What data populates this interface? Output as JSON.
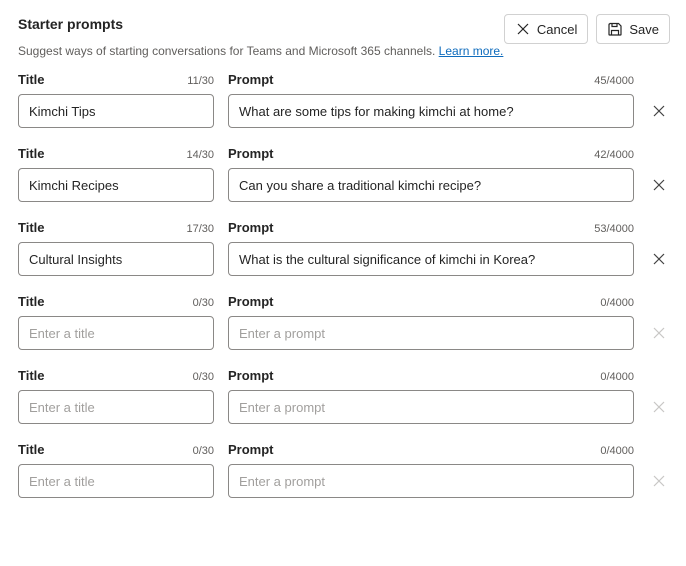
{
  "header": {
    "title": "Starter prompts",
    "subtitle_prefix": "Suggest ways of starting conversations for Teams and Microsoft 365 channels. ",
    "learn_more": "Learn more.",
    "cancel": "Cancel",
    "save": "Save"
  },
  "labels": {
    "title": "Title",
    "prompt": "Prompt",
    "title_max": 30,
    "prompt_max": 4000,
    "title_placeholder": "Enter a title",
    "prompt_placeholder": "Enter a prompt"
  },
  "rows": [
    {
      "title": "Kimchi Tips",
      "prompt": "What are some tips for making kimchi at home?",
      "title_count": "11/30",
      "prompt_count": "45/4000",
      "deletable": true
    },
    {
      "title": "Kimchi Recipes",
      "prompt": "Can you share a traditional kimchi recipe?",
      "title_count": "14/30",
      "prompt_count": "42/4000",
      "deletable": true
    },
    {
      "title": "Cultural Insights",
      "prompt": "What is the cultural significance of kimchi in Korea?",
      "title_count": "17/30",
      "prompt_count": "53/4000",
      "deletable": true
    },
    {
      "title": "",
      "prompt": "",
      "title_count": "0/30",
      "prompt_count": "0/4000",
      "deletable": false
    },
    {
      "title": "",
      "prompt": "",
      "title_count": "0/30",
      "prompt_count": "0/4000",
      "deletable": false
    },
    {
      "title": "",
      "prompt": "",
      "title_count": "0/30",
      "prompt_count": "0/4000",
      "deletable": false
    }
  ]
}
